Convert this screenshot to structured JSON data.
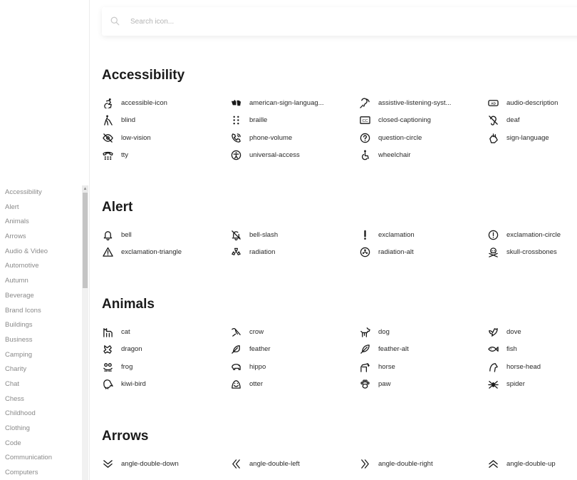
{
  "search": {
    "placeholder": "Search icon..."
  },
  "categories": [
    "Accessibility",
    "Alert",
    "Animals",
    "Arrows",
    "Audio & Video",
    "Automotive",
    "Autumn",
    "Beverage",
    "Brand Icons",
    "Buildings",
    "Business",
    "Camping",
    "Charity",
    "Chat",
    "Chess",
    "Childhood",
    "Clothing",
    "Code",
    "Communication",
    "Computers"
  ],
  "sections": [
    {
      "title": "Accessibility",
      "items": [
        {
          "icon": "accessible-icon",
          "label": "accessible-icon"
        },
        {
          "icon": "american-sign-language-icon",
          "label": "american-sign-languag..."
        },
        {
          "icon": "assistive-listening-icon",
          "label": "assistive-listening-syst..."
        },
        {
          "icon": "audio-description-icon",
          "label": "audio-description"
        },
        {
          "icon": "blind-icon",
          "label": "blind"
        },
        {
          "icon": "braille-icon",
          "label": "braille"
        },
        {
          "icon": "closed-captioning-icon",
          "label": "closed-captioning"
        },
        {
          "icon": "deaf-icon",
          "label": "deaf"
        },
        {
          "icon": "low-vision-icon",
          "label": "low-vision"
        },
        {
          "icon": "phone-volume-icon",
          "label": "phone-volume"
        },
        {
          "icon": "question-circle-icon",
          "label": "question-circle"
        },
        {
          "icon": "sign-language-icon",
          "label": "sign-language"
        },
        {
          "icon": "tty-icon",
          "label": "tty"
        },
        {
          "icon": "universal-access-icon",
          "label": "universal-access"
        },
        {
          "icon": "wheelchair-icon",
          "label": "wheelchair"
        }
      ]
    },
    {
      "title": "Alert",
      "items": [
        {
          "icon": "bell-icon",
          "label": "bell"
        },
        {
          "icon": "bell-slash-icon",
          "label": "bell-slash"
        },
        {
          "icon": "exclamation-icon",
          "label": "exclamation"
        },
        {
          "icon": "exclamation-circle-icon",
          "label": "exclamation-circle"
        },
        {
          "icon": "exclamation-triangle-icon",
          "label": "exclamation-triangle"
        },
        {
          "icon": "radiation-icon",
          "label": "radiation"
        },
        {
          "icon": "radiation-alt-icon",
          "label": "radiation-alt"
        },
        {
          "icon": "skull-crossbones-icon",
          "label": "skull-crossbones"
        }
      ]
    },
    {
      "title": "Animals",
      "items": [
        {
          "icon": "cat-icon",
          "label": "cat"
        },
        {
          "icon": "crow-icon",
          "label": "crow"
        },
        {
          "icon": "dog-icon",
          "label": "dog"
        },
        {
          "icon": "dove-icon",
          "label": "dove"
        },
        {
          "icon": "dragon-icon",
          "label": "dragon"
        },
        {
          "icon": "feather-icon",
          "label": "feather"
        },
        {
          "icon": "feather-alt-icon",
          "label": "feather-alt"
        },
        {
          "icon": "fish-icon",
          "label": "fish"
        },
        {
          "icon": "frog-icon",
          "label": "frog"
        },
        {
          "icon": "hippo-icon",
          "label": "hippo"
        },
        {
          "icon": "horse-icon",
          "label": "horse"
        },
        {
          "icon": "horse-head-icon",
          "label": "horse-head"
        },
        {
          "icon": "kiwi-bird-icon",
          "label": "kiwi-bird"
        },
        {
          "icon": "otter-icon",
          "label": "otter"
        },
        {
          "icon": "paw-icon",
          "label": "paw"
        },
        {
          "icon": "spider-icon",
          "label": "spider"
        }
      ]
    },
    {
      "title": "Arrows",
      "items": [
        {
          "icon": "angle-double-down-icon",
          "label": "angle-double-down"
        },
        {
          "icon": "angle-double-left-icon",
          "label": "angle-double-left"
        },
        {
          "icon": "angle-double-right-icon",
          "label": "angle-double-right"
        },
        {
          "icon": "angle-double-up-icon",
          "label": "angle-double-up"
        }
      ]
    }
  ]
}
